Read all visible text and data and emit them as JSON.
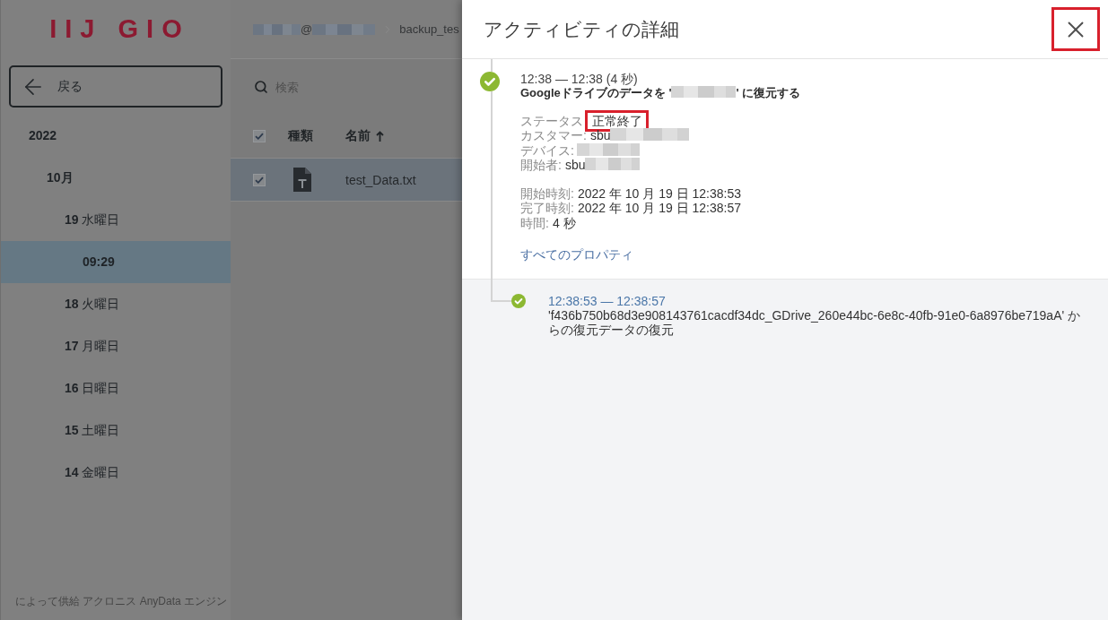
{
  "sidebar": {
    "logo": "IIJ GIO",
    "back_button": "戻る",
    "tree": [
      {
        "label": "2022",
        "selected": false,
        "children": [
          {
            "label": "10月",
            "selected": false,
            "children": [
              {
                "label": "**19** 水曜日",
                "selected": false,
                "children": [
                  {
                    "label": "09:29",
                    "selected": true
                  }
                ]
              },
              {
                "label": "**18** 火曜日",
                "selected": false
              },
              {
                "label": "**17** 月曜日",
                "selected": false
              },
              {
                "label": "**16** 日曜日",
                "selected": false
              },
              {
                "label": "**15** 土曜日",
                "selected": false
              },
              {
                "label": "**14** 金曜日",
                "selected": false
              }
            ]
          }
        ]
      }
    ],
    "footer": "によって供給 アクロニス AnyData エンジン"
  },
  "main": {
    "breadcrumb": [
      {
        "kind": "account",
        "text": "@",
        "redacted": true
      },
      {
        "kind": "folder",
        "text": "backup_tes"
      }
    ],
    "search": {
      "placeholder": "検索"
    },
    "table": {
      "select_all_checked": true,
      "columns": [
        {
          "label": "種類",
          "sorted": false
        },
        {
          "label": "名前",
          "sorted": true
        }
      ],
      "rows": [
        {
          "kind": "text",
          "name": "test_Data.txt",
          "checked": true,
          "selected": true
        }
      ]
    }
  },
  "panel": {
    "title": "アクティビティの詳細",
    "close_highlighted": true,
    "activity": {
      "succeeded": true,
      "time": "12:38 — 12:38 (4 秒)",
      "title_before": "Googleドライブのデータを '",
      "title_redacted": true,
      "title_after": "' に復元する",
      "status": {
        "label": "ステータス",
        "value": "正常終了",
        "highlighted": true
      },
      "properties": [
        {
          "label": "カスタマー:",
          "value": "sbu",
          "redacted": true
        },
        {
          "label": "デバイス:",
          "redacted": true
        },
        {
          "label": "開始者:",
          "value": "sbu",
          "redacted": true
        }
      ],
      "times": [
        {
          "label": "開始時刻:",
          "value": "2022 年 10 月 19 日 12:38:53"
        },
        {
          "label": "完了時刻:",
          "value": "2022 年 10 月 19 日 12:38:57"
        },
        {
          "label": "時間:",
          "value": "4 秒"
        }
      ],
      "link": "すべてのプロパティ"
    },
    "sub_activities": [
      {
        "succeeded": true,
        "time": "12:38:53 — 12:38:57",
        "description": "'f436b750b68d3e908143761cacdf34dc_GDrive_260e44bc-6e8c-40fb-91e0-6a8976be719aA' からの復元データの復元"
      }
    ]
  }
}
